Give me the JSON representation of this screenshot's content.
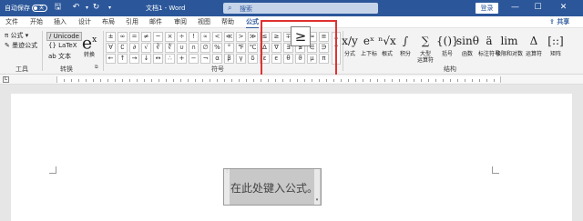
{
  "titlebar": {
    "autosave_label": "自动保存",
    "autosave_state": "关",
    "doc_title": "文档1 - Word",
    "search_placeholder": "搜索",
    "login_label": "登录",
    "background_color": "#2b579a"
  },
  "tabs": [
    "文件",
    "开始",
    "插入",
    "设计",
    "布局",
    "引用",
    "邮件",
    "审阅",
    "视图",
    "帮助",
    "公式"
  ],
  "active_tab": "公式",
  "share_label": "共享",
  "tools_group": {
    "formula_label": "公式",
    "ink_label": "墨迹公式",
    "group_label": "工具"
  },
  "convert_group": {
    "unicode_label": "Unicode",
    "latex_label": "LaTeX",
    "text_label": "文本",
    "convert_icon_text": "e",
    "convert_icon_sup": "x",
    "convert_label": "转换",
    "group_label": "转换"
  },
  "symbols_group": {
    "group_label": "符号",
    "row1": [
      "±",
      "∞",
      "=",
      "≠",
      "~",
      "×",
      "÷",
      "!",
      "∝",
      "<",
      "≪",
      ">",
      "≫",
      "≤",
      "≥",
      "∓",
      "≅",
      "≈",
      "≡"
    ],
    "row2": [
      "∀",
      "∁",
      "∂",
      "√",
      "∛",
      "∜",
      "∪",
      "∩",
      "∅",
      "%",
      "°",
      "℉",
      "℃",
      "∆",
      "∇",
      "∃",
      "∄",
      "∈",
      "∋"
    ],
    "row3": [
      "←",
      "↑",
      "→",
      "↓",
      "↔",
      "∴",
      "+",
      "−",
      "¬",
      "α",
      "β",
      "γ",
      "δ",
      "ε",
      "ϵ",
      "θ",
      "ϑ",
      "μ",
      "π"
    ],
    "hover_symbol": "≥"
  },
  "structures_group": {
    "group_label": "结构",
    "buttons": [
      {
        "icon": "x/y",
        "label": "分式"
      },
      {
        "icon": "eˣ",
        "label": "上下标"
      },
      {
        "icon": "ⁿ√x",
        "label": "根式"
      },
      {
        "icon": "∫",
        "label": "积分"
      },
      {
        "icon": "∑",
        "label": "大型\n运算符"
      },
      {
        "icon": "{()}",
        "label": "括号"
      },
      {
        "icon": "sinθ",
        "label": "函数"
      },
      {
        "icon": "ä",
        "label": "标注符号"
      },
      {
        "icon": "lim",
        "label": "极限和对数"
      },
      {
        "icon": "Δ",
        "label": "运算符"
      },
      {
        "icon": "[::]",
        "label": "矩阵"
      }
    ]
  },
  "equation_placeholder": "在此处键入公式。",
  "highlight_color": "#e03131"
}
